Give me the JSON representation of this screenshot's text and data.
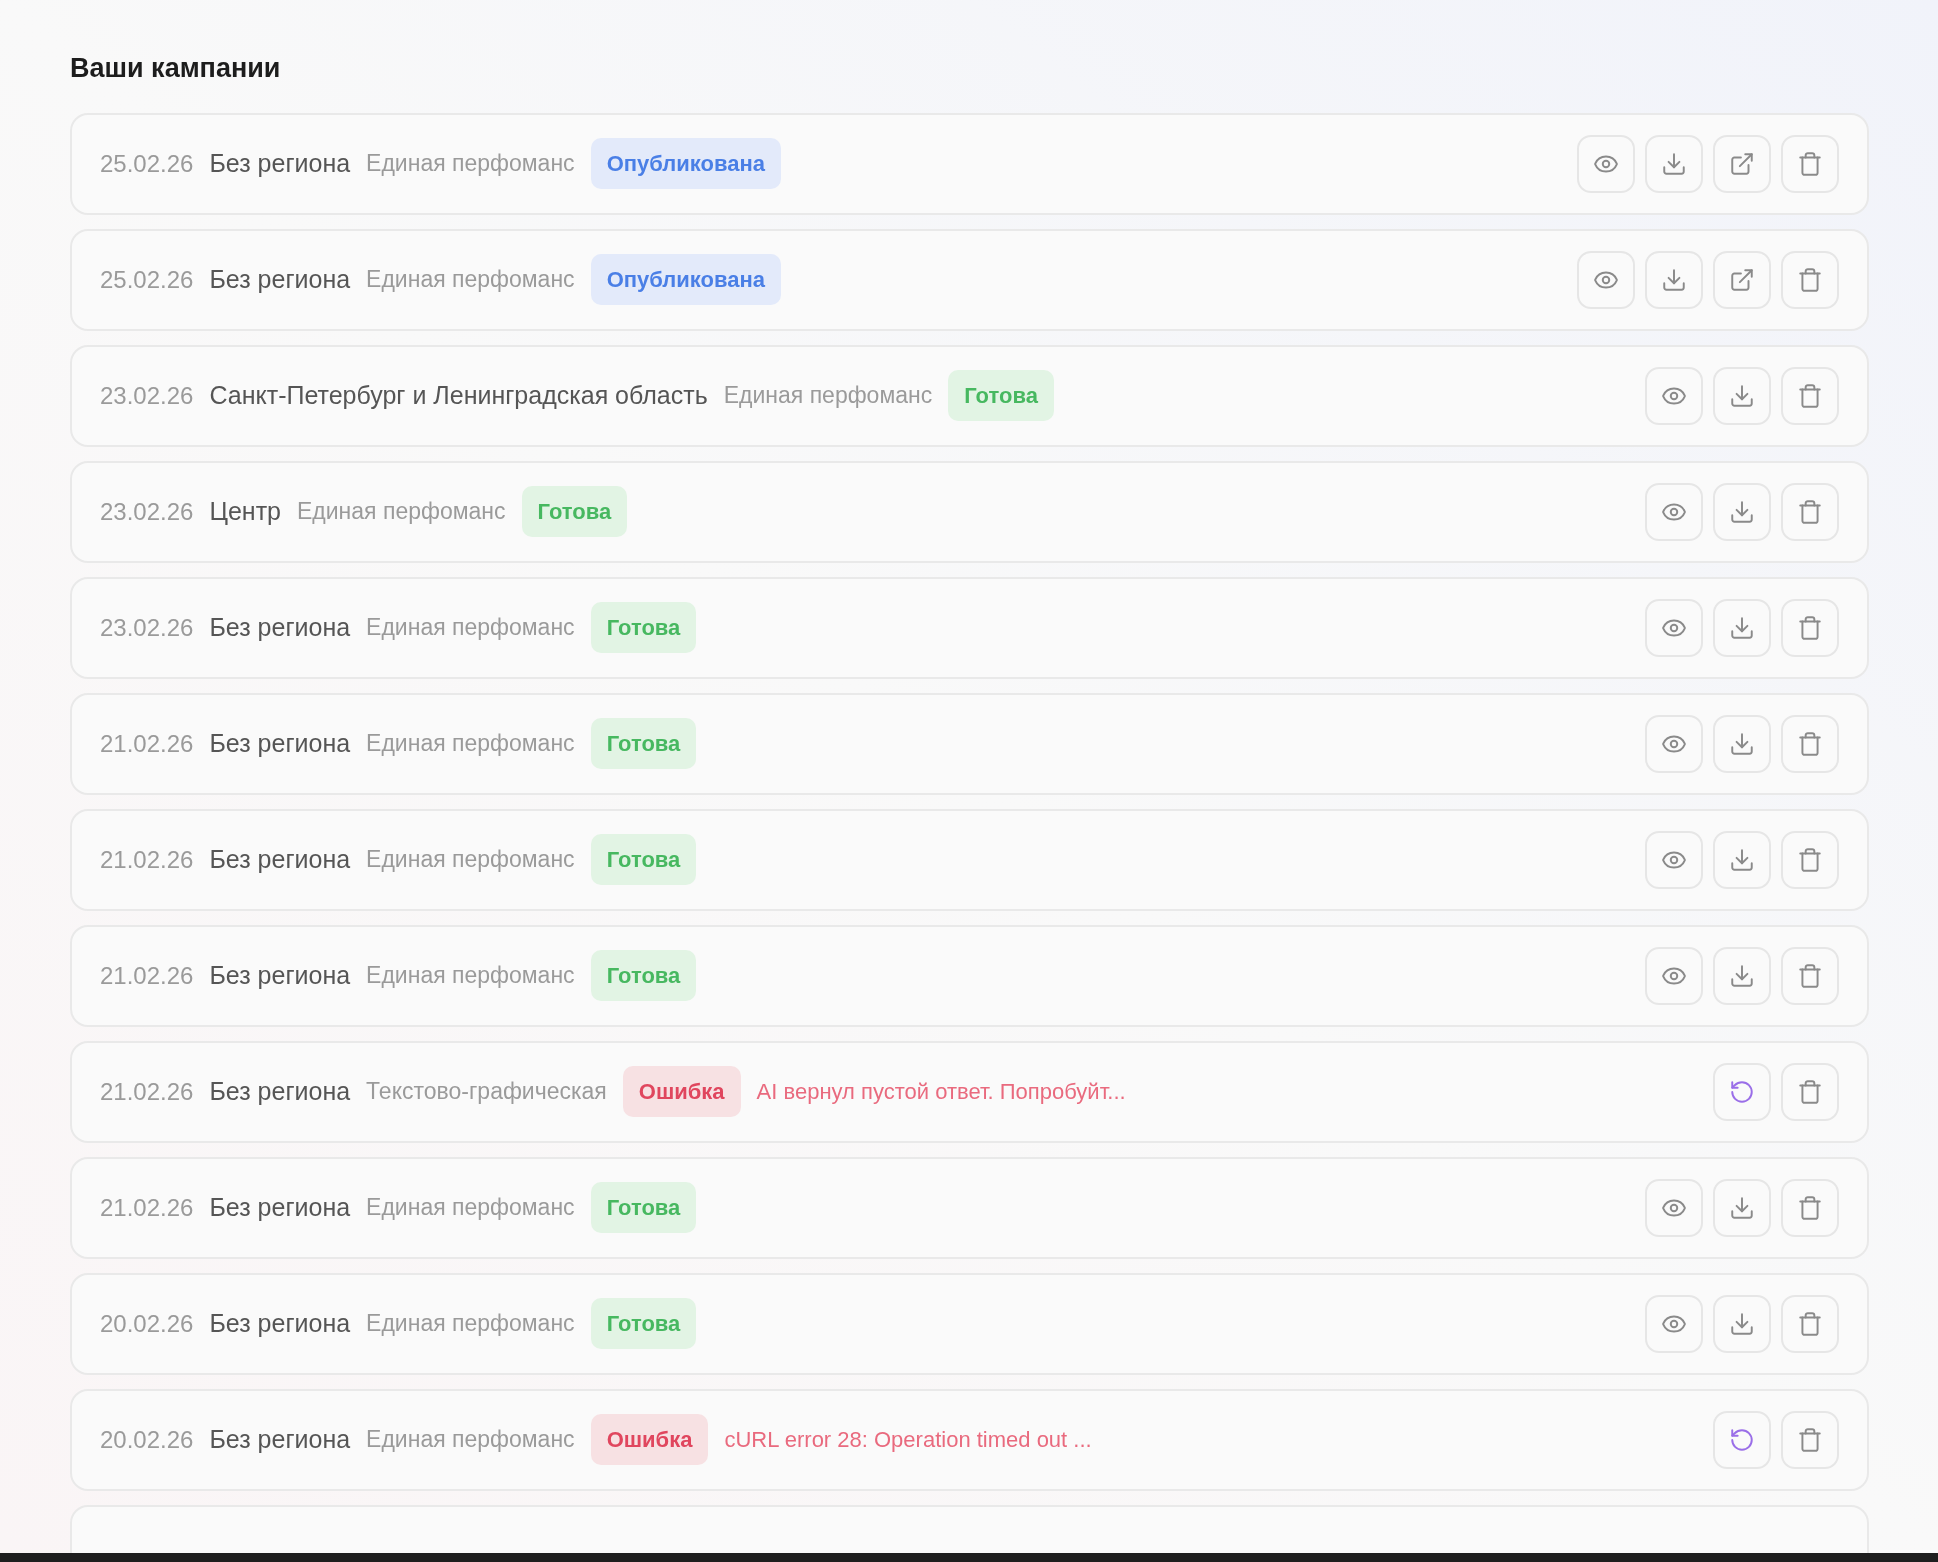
{
  "title": "Ваши кампании",
  "campaigns": [
    {
      "date": "25.02.26",
      "region": "Без региона",
      "type": "Единая перфоманс",
      "status": {
        "kind": "published",
        "label": "Опубликована"
      },
      "actions": [
        {
          "kind": "view"
        },
        {
          "kind": "download"
        },
        {
          "kind": "open"
        },
        {
          "kind": "delete"
        }
      ]
    },
    {
      "date": "25.02.26",
      "region": "Без региона",
      "type": "Единая перфоманс",
      "status": {
        "kind": "published",
        "label": "Опубликована"
      },
      "actions": [
        {
          "kind": "view"
        },
        {
          "kind": "download"
        },
        {
          "kind": "open"
        },
        {
          "kind": "delete"
        }
      ]
    },
    {
      "date": "23.02.26",
      "region": "Санкт-Петербург и Ленинградская область",
      "type": "Единая перфоманс",
      "status": {
        "kind": "ready",
        "label": "Готова"
      },
      "actions": [
        {
          "kind": "view"
        },
        {
          "kind": "download"
        },
        {
          "kind": "delete"
        }
      ]
    },
    {
      "date": "23.02.26",
      "region": "Центр",
      "type": "Единая перфоманс",
      "status": {
        "kind": "ready",
        "label": "Готова"
      },
      "actions": [
        {
          "kind": "view"
        },
        {
          "kind": "download"
        },
        {
          "kind": "delete"
        }
      ]
    },
    {
      "date": "23.02.26",
      "region": "Без региона",
      "type": "Единая перфоманс",
      "status": {
        "kind": "ready",
        "label": "Готова"
      },
      "actions": [
        {
          "kind": "view"
        },
        {
          "kind": "download"
        },
        {
          "kind": "delete"
        }
      ]
    },
    {
      "date": "21.02.26",
      "region": "Без региона",
      "type": "Единая перфоманс",
      "status": {
        "kind": "ready",
        "label": "Готова"
      },
      "actions": [
        {
          "kind": "view"
        },
        {
          "kind": "download"
        },
        {
          "kind": "delete"
        }
      ]
    },
    {
      "date": "21.02.26",
      "region": "Без региона",
      "type": "Единая перфоманс",
      "status": {
        "kind": "ready",
        "label": "Готова"
      },
      "actions": [
        {
          "kind": "view"
        },
        {
          "kind": "download"
        },
        {
          "kind": "delete"
        }
      ]
    },
    {
      "date": "21.02.26",
      "region": "Без региона",
      "type": "Единая перфоманс",
      "status": {
        "kind": "ready",
        "label": "Готова"
      },
      "actions": [
        {
          "kind": "view"
        },
        {
          "kind": "download"
        },
        {
          "kind": "delete"
        }
      ]
    },
    {
      "date": "21.02.26",
      "region": "Без региона",
      "type": "Текстово-графическая",
      "status": {
        "kind": "error",
        "label": "Ошибка"
      },
      "error": "AI вернул пустой ответ. Попробуйт...",
      "actions": [
        {
          "kind": "retry"
        },
        {
          "kind": "delete"
        }
      ]
    },
    {
      "date": "21.02.26",
      "region": "Без региона",
      "type": "Единая перфоманс",
      "status": {
        "kind": "ready",
        "label": "Готова"
      },
      "actions": [
        {
          "kind": "view"
        },
        {
          "kind": "download"
        },
        {
          "kind": "delete"
        }
      ]
    },
    {
      "date": "20.02.26",
      "region": "Без региона",
      "type": "Единая перфоманс",
      "status": {
        "kind": "ready",
        "label": "Готова"
      },
      "actions": [
        {
          "kind": "view"
        },
        {
          "kind": "download"
        },
        {
          "kind": "delete"
        }
      ]
    },
    {
      "date": "20.02.26",
      "region": "Без региона",
      "type": "Единая перфоманс",
      "status": {
        "kind": "error",
        "label": "Ошибка"
      },
      "error": "cURL error 28: Operation timed out ...",
      "actions": [
        {
          "kind": "retry"
        },
        {
          "kind": "delete"
        }
      ]
    }
  ]
}
